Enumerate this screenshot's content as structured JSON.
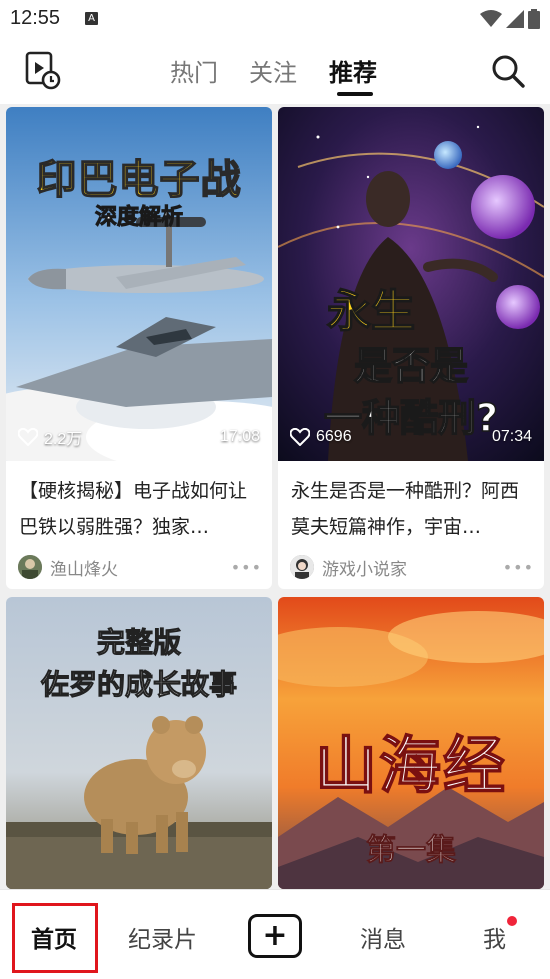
{
  "status_bar": {
    "time": "12:55",
    "notification_icon_letter": "A"
  },
  "header": {
    "tabs": [
      "热门",
      "关注",
      "推荐"
    ],
    "active_tab": "推荐"
  },
  "cards": [
    {
      "thumb_title": "印巴电子战",
      "thumb_subtitle": "深度解析",
      "likes": "2.2万",
      "duration": "17:08",
      "title": "【硬核揭秘】电子战如何让巴铁以弱胜强？独家…",
      "author": "渔山烽火"
    },
    {
      "thumb_title": "永生",
      "thumb_subtitle": "是否是",
      "thumb_line3": "一种酷刑?",
      "likes": "6696",
      "duration": "07:34",
      "title": "永生是否是一种酷刑？阿西莫夫短篇神作，宇宙…",
      "author": "游戏小说家"
    },
    {
      "thumb_title": "完整版",
      "thumb_subtitle": "佐罗的成长故事"
    },
    {
      "thumb_title": "山海经",
      "thumb_subtitle": "第一集"
    }
  ],
  "bottom_nav": {
    "home": "首页",
    "documentary": "纪录片",
    "add": "+",
    "messages": "消息",
    "me": "我"
  },
  "colors": {
    "accent_red": "#e0161c",
    "notification_dot": "#f0243a",
    "text_primary": "#222222",
    "text_secondary": "#888888"
  }
}
